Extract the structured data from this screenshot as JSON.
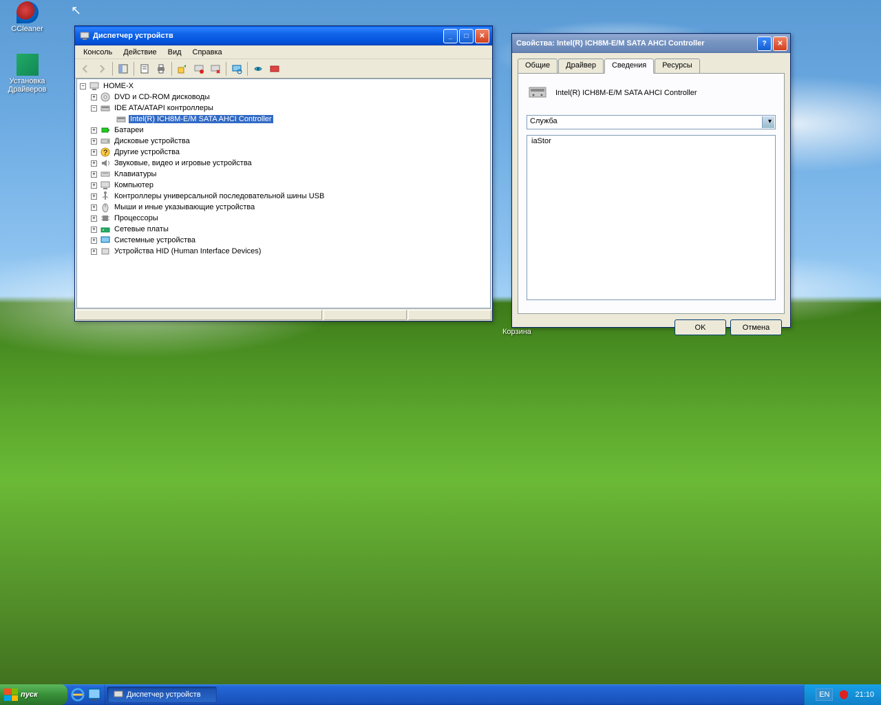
{
  "desktop": {
    "icons": [
      {
        "label": "CCleaner"
      },
      {
        "label": "Установка Драйверов"
      }
    ],
    "recycle_label": "Корзина"
  },
  "devmgr": {
    "title": "Диспетчер устройств",
    "menu": [
      "Консоль",
      "Действие",
      "Вид",
      "Справка"
    ],
    "tree": {
      "root": "HOME-X",
      "nodes": [
        {
          "label": "DVD и CD-ROM дисководы",
          "expanded": false
        },
        {
          "label": "IDE ATA/ATAPI контроллеры",
          "expanded": true,
          "children": [
            {
              "label": "Intel(R) ICH8M-E/M SATA AHCI Controller",
              "selected": true
            }
          ]
        },
        {
          "label": "Батареи",
          "expanded": false
        },
        {
          "label": "Дисковые устройства",
          "expanded": false
        },
        {
          "label": "Другие устройства",
          "expanded": false
        },
        {
          "label": "Звуковые, видео и игровые устройства",
          "expanded": false
        },
        {
          "label": "Клавиатуры",
          "expanded": false
        },
        {
          "label": "Компьютер",
          "expanded": false
        },
        {
          "label": "Контроллеры универсальной последовательной шины USB",
          "expanded": false
        },
        {
          "label": "Мыши и иные указывающие устройства",
          "expanded": false
        },
        {
          "label": "Процессоры",
          "expanded": false
        },
        {
          "label": "Сетевые платы",
          "expanded": false
        },
        {
          "label": "Системные устройства",
          "expanded": false
        },
        {
          "label": "Устройства HID (Human Interface Devices)",
          "expanded": false
        }
      ]
    }
  },
  "propdlg": {
    "title": "Свойства: Intel(R) ICH8M-E/M SATA AHCI Controller",
    "tabs": [
      "Общие",
      "Драйвер",
      "Сведения",
      "Ресурсы"
    ],
    "active_tab": 2,
    "device_name": "Intel(R) ICH8M-E/M SATA AHCI Controller",
    "dropdown_value": "Служба",
    "list_value": "iaStor",
    "ok": "OK",
    "cancel": "Отмена"
  },
  "taskbar": {
    "start": "пуск",
    "task_button": "Диспетчер устройств",
    "lang": "EN",
    "clock": "21:10"
  }
}
